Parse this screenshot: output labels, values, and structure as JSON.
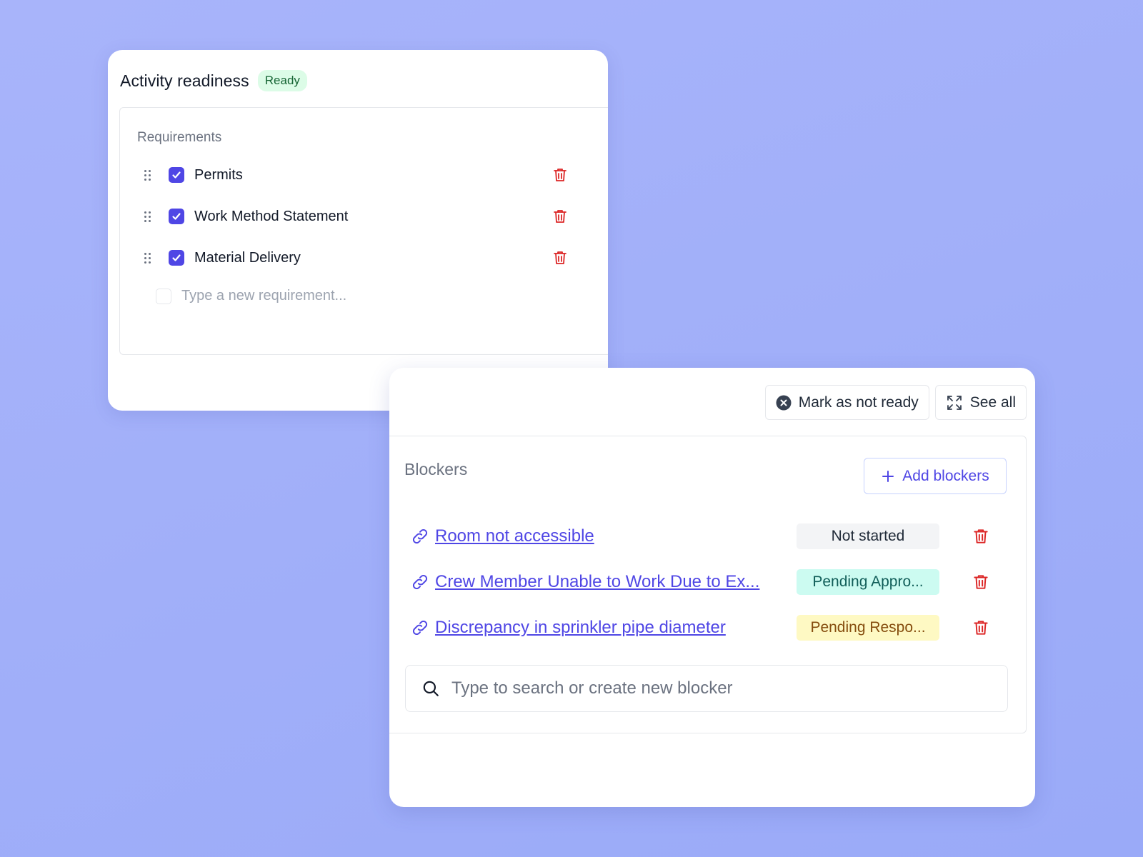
{
  "readiness": {
    "title": "Activity readiness",
    "badge": "Ready",
    "requirements_label": "Requirements",
    "requirements": [
      {
        "label": "Permits",
        "checked": true
      },
      {
        "label": "Work Method Statement",
        "checked": true
      },
      {
        "label": "Material Delivery",
        "checked": true
      }
    ],
    "new_requirement_placeholder": "Type a new requirement..."
  },
  "blockers_panel": {
    "mark_not_ready_label": "Mark as not ready",
    "see_all_label": "See all",
    "blockers_label": "Blockers",
    "add_blockers_label": "Add blockers",
    "blockers": [
      {
        "title": "Room not accessible",
        "status": "Not started",
        "status_color": "gray"
      },
      {
        "title": "Crew Member Unable to Work Due to Ex...",
        "status": "Pending Appro...",
        "status_color": "teal"
      },
      {
        "title": "Discrepancy in sprinkler pipe diameter",
        "status": "Pending Respo...",
        "status_color": "yellow"
      }
    ],
    "search_placeholder": "Type to search or create new blocker"
  },
  "colors": {
    "accent": "#4f46e5",
    "danger": "#dc2626",
    "ready_badge_bg": "#dcfce7",
    "ready_badge_text": "#166534"
  },
  "icons": [
    "drag-handle-icon",
    "check-icon",
    "trash-icon",
    "x-circle-icon",
    "expand-icon",
    "plus-icon",
    "link-icon",
    "search-icon"
  ]
}
